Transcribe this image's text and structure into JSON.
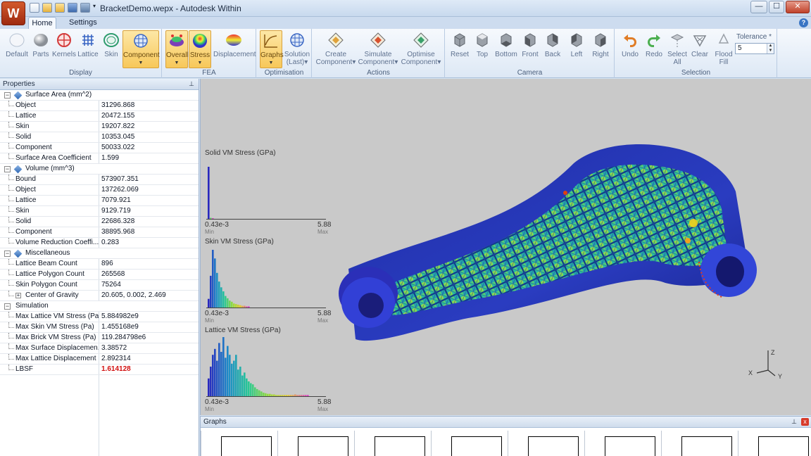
{
  "app": {
    "logo_glyph": "W",
    "window_title": "BracketDemo.wepx - Autodesk Within",
    "window_buttons": {
      "minimize": "—",
      "maximize": "☐",
      "close": "✕"
    }
  },
  "tabs": [
    {
      "label": "Home",
      "active": true
    },
    {
      "label": "Settings",
      "active": false
    }
  ],
  "help_glyph": "?",
  "ribbon": {
    "display": {
      "label": "Display",
      "buttons": [
        {
          "label": "Default",
          "icon": "default-sphere-icon"
        },
        {
          "label": "Parts",
          "icon": "parts-sphere-icon"
        },
        {
          "label": "Kernels",
          "icon": "kernels-icon"
        },
        {
          "label": "Lattice",
          "icon": "lattice-grid-icon"
        },
        {
          "label": "Skin",
          "icon": "skin-ring-icon"
        },
        {
          "label": "Component",
          "icon": "component-icon",
          "active": true
        }
      ]
    },
    "fea": {
      "label": "FEA",
      "buttons": [
        {
          "label": "Overall",
          "icon": "overall-icon",
          "active": true
        },
        {
          "label": "Stress",
          "icon": "stress-icon",
          "active": true
        },
        {
          "label": "Displacement",
          "icon": "displacement-icon"
        }
      ]
    },
    "optimisation": {
      "label": "Optimisation",
      "buttons": [
        {
          "label": "Graphs",
          "icon": "graphs-icon",
          "active": true
        },
        {
          "label_line1": "Solution",
          "label_line2": "(Last)",
          "icon": "solution-icon"
        }
      ]
    },
    "actions": {
      "label": "Actions",
      "buttons": [
        {
          "label_line1": "Create",
          "label_line2": "Component",
          "icon": "create-component-icon"
        },
        {
          "label_line1": "Simulate",
          "label_line2": "Component",
          "icon": "simulate-component-icon"
        },
        {
          "label_line1": "Optimise",
          "label_line2": "Component",
          "icon": "optimise-component-icon"
        }
      ]
    },
    "camera": {
      "label": "Camera",
      "buttons": [
        "Reset",
        "Top",
        "Bottom",
        "Front",
        "Back",
        "Left",
        "Right"
      ]
    },
    "selection": {
      "label": "Selection",
      "buttons": [
        {
          "label": "Undo"
        },
        {
          "label": "Redo"
        },
        {
          "label_line1": "Select",
          "label_line2": "All"
        },
        {
          "label": "Clear"
        },
        {
          "label_line1": "Flood",
          "label_line2": "Fill"
        }
      ],
      "tolerance_label": "Tolerance *",
      "tolerance_value": "5"
    }
  },
  "properties": {
    "title": "Properties",
    "pin_glyph": "⊥",
    "categories": [
      {
        "name": "Surface Area (mm^2)",
        "rows": [
          {
            "name": "Object",
            "value": "31296.868"
          },
          {
            "name": "Lattice",
            "value": "20472.155"
          },
          {
            "name": "Skin",
            "value": "19207.822"
          },
          {
            "name": "Solid",
            "value": "10353.045"
          },
          {
            "name": "Component",
            "value": "50033.022"
          },
          {
            "name": "Surface Area Coefficient",
            "value": "1.599"
          }
        ]
      },
      {
        "name": "Volume (mm^3)",
        "rows": [
          {
            "name": "Bound",
            "value": "573907.351"
          },
          {
            "name": "Object",
            "value": "137262.069"
          },
          {
            "name": "Lattice",
            "value": "7079.921"
          },
          {
            "name": "Skin",
            "value": "9129.719"
          },
          {
            "name": "Solid",
            "value": "22686.328"
          },
          {
            "name": "Component",
            "value": "38895.968"
          },
          {
            "name": "Volume Reduction Coeffi...",
            "value": "0.283"
          }
        ]
      },
      {
        "name": "Miscellaneous",
        "rows": [
          {
            "name": "Lattice Beam Count",
            "value": "896"
          },
          {
            "name": "Lattice Polygon Count",
            "value": "265568"
          },
          {
            "name": "Skin Polygon Count",
            "value": "75264"
          },
          {
            "name": "Center of Gravity",
            "value": "20.605, 0.002, 2.469",
            "expandable": true
          }
        ]
      },
      {
        "name": "Simulation",
        "rows": [
          {
            "name": "Max Lattice VM Stress (Pa)",
            "value": "5.884982e9"
          },
          {
            "name": "Max Skin VM Stress (Pa)",
            "value": "1.455168e9"
          },
          {
            "name": "Max Brick VM Stress (Pa)",
            "value": "119.284798e6"
          },
          {
            "name": "Max Surface Displacemen...",
            "value": "3.38572"
          },
          {
            "name": "Max Lattice Displacement ...",
            "value": "2.892314"
          },
          {
            "name": "LBSF",
            "value": "1.614128",
            "highlight": true
          }
        ]
      }
    ]
  },
  "histograms": [
    {
      "title": "Solid VM Stress (GPa)",
      "min": "0.43e-3",
      "max": "5.88",
      "min_sub": "Min",
      "max_sub": "Max",
      "bins": [
        1.0,
        0.02,
        0.01
      ]
    },
    {
      "title": "Skin VM Stress (GPa)",
      "min": "0.43e-3",
      "max": "5.88",
      "min_sub": "Min",
      "max_sub": "Max",
      "bins": [
        0.15,
        0.55,
        1.0,
        0.85,
        0.6,
        0.45,
        0.35,
        0.28,
        0.2,
        0.16,
        0.12,
        0.1,
        0.07,
        0.06,
        0.05,
        0.04,
        0.03,
        0.03,
        0.02,
        0.02
      ]
    },
    {
      "title": "Lattice VM Stress (GPa)",
      "min": "0.43e-3",
      "max": "5.88",
      "min_sub": "Min",
      "max_sub": "Max",
      "bins": [
        0.3,
        0.5,
        0.7,
        0.8,
        0.6,
        0.9,
        0.75,
        1.0,
        0.65,
        0.85,
        0.7,
        0.55,
        0.6,
        0.7,
        0.45,
        0.5,
        0.35,
        0.4,
        0.3,
        0.25,
        0.22,
        0.2,
        0.15,
        0.12,
        0.1,
        0.08,
        0.06,
        0.05,
        0.04,
        0.04,
        0.03,
        0.03,
        0.02,
        0.02,
        0.02,
        0.02,
        0.02,
        0.02,
        0.02,
        0.02,
        0.02,
        0.03,
        0.02,
        0.02,
        0.02,
        0.02,
        0.02,
        0.02
      ]
    }
  ],
  "axis_triad": {
    "z": "Z",
    "x": "X",
    "y": "Y"
  },
  "graphs_panel": {
    "title": "Graphs",
    "pin_glyph": "⊥",
    "close_glyph": "x",
    "thumb_count": 8
  }
}
